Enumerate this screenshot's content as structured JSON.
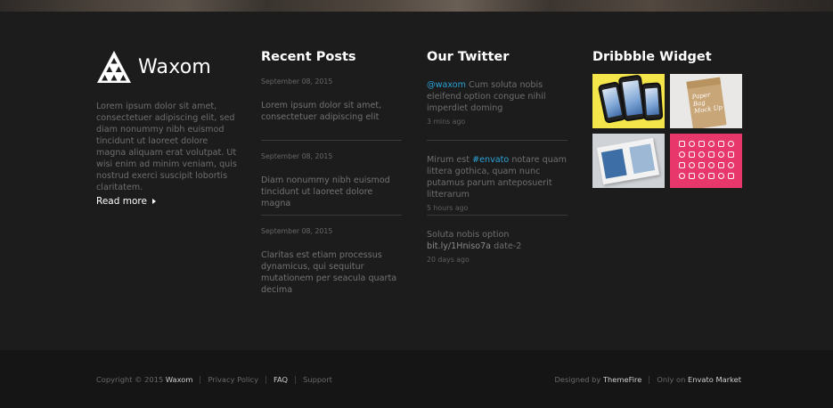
{
  "brand": {
    "name": "Waxom"
  },
  "about": {
    "text": "Lorem ipsum dolor sit amet, consectetuer adipiscing elit, sed diam nonummy nibh euismod tincidunt ut laoreet dolore magna aliquam erat volutpat. Ut wisi enim ad minim veniam, quis nostrud exerci suscipit lobortis claritatem.",
    "read_more": "Read more"
  },
  "recent_posts": {
    "title": "Recent Posts",
    "items": [
      {
        "date": "September 08, 2015",
        "title": "Lorem ipsum dolor sit amet, consectetuer adipiscing elit"
      },
      {
        "date": "September 08, 2015",
        "title": "Diam nonummy nibh euismod tincidunt ut laoreet dolore magna"
      },
      {
        "date": "September 08, 2015",
        "title": "Claritas est etiam processus dynamicus, qui sequitur mutationem per seacula quarta decima"
      }
    ]
  },
  "twitter": {
    "title": "Our Twitter",
    "tweets": [
      {
        "handle": "@waxom",
        "text": " Cum soluta nobis eleifend option congue nihil imperdiet doming",
        "time": "3 mins ago"
      },
      {
        "pre": "Mirum est ",
        "hashtag": "#envato",
        "post": " notare quam littera gothica, quam nunc putamus parum anteposuerit litterarum",
        "time": "5 hours ago"
      },
      {
        "pre": "Soluta nobis option ",
        "link": "bit.ly/1Hniso7a",
        "post": " date-2",
        "time": "20 days ago"
      }
    ]
  },
  "dribbble": {
    "title": "Dribbble Widget",
    "shots": [
      {
        "label": "phones-mockup",
        "color": "#f3e54a"
      },
      {
        "label": "paper-bag-mockup",
        "color": "#e9e8e6",
        "text": "Paper Bag Mock Up"
      },
      {
        "label": "magazine-mockup",
        "color": "#cfd2d6"
      },
      {
        "label": "icon-set",
        "color": "#e8386b"
      }
    ]
  },
  "footer": {
    "copyright_prefix": "Copyright © 2015 ",
    "copyright_brand": "Waxom",
    "links": [
      {
        "label": "Privacy Policy",
        "active": false
      },
      {
        "label": "FAQ",
        "active": true
      },
      {
        "label": "Support",
        "active": false
      }
    ],
    "designed_prefix": "Designed by ",
    "designed_brand": "ThemeFire",
    "only_prefix": "Only on ",
    "only_brand": "Envato Market"
  }
}
